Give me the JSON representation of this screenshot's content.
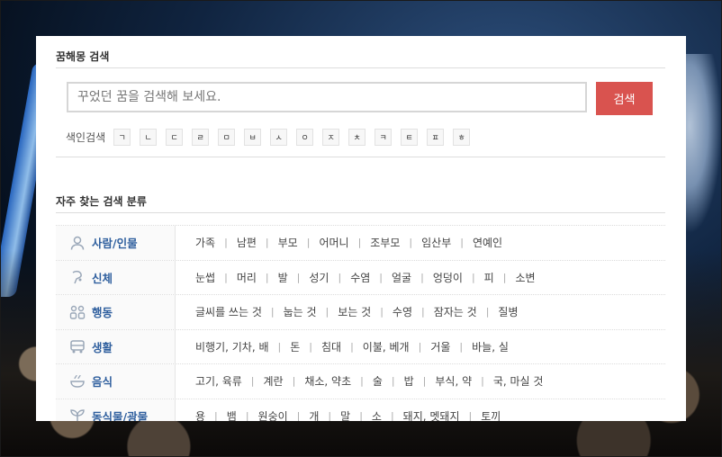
{
  "search": {
    "title": "꿈해몽 검색",
    "placeholder": "꾸었던 꿈을 검색해 보세요.",
    "button": "검색",
    "index_label": "색인검색",
    "index_keys": [
      "ㄱ",
      "ㄴ",
      "ㄷ",
      "ㄹ",
      "ㅁ",
      "ㅂ",
      "ㅅ",
      "ㅇ",
      "ㅈ",
      "ㅊ",
      "ㅋ",
      "ㅌ",
      "ㅍ",
      "ㅎ"
    ]
  },
  "categories": {
    "title": "자주 찾는 검색 분류",
    "accent_color": "#2f5f9e",
    "rows": [
      {
        "label": "사람/인물",
        "icon": "person-icon",
        "items": [
          "가족",
          "남편",
          "부모",
          "어머니",
          "조부모",
          "임산부",
          "연예인"
        ]
      },
      {
        "label": "신체",
        "icon": "body-icon",
        "items": [
          "눈썹",
          "머리",
          "발",
          "성기",
          "수염",
          "얼굴",
          "엉덩이",
          "피",
          "소변"
        ]
      },
      {
        "label": "행동",
        "icon": "people-icon",
        "items": [
          "글씨를 쓰는 것",
          "눕는 것",
          "보는 것",
          "수영",
          "잠자는 것",
          "질병"
        ]
      },
      {
        "label": "생활",
        "icon": "vehicle-icon",
        "items": [
          "비행기, 기차, 배",
          "돈",
          "침대",
          "이불, 베개",
          "거울",
          "바늘, 실"
        ]
      },
      {
        "label": "음식",
        "icon": "food-icon",
        "items": [
          "고기, 육류",
          "계란",
          "채소, 약초",
          "술",
          "밥",
          "부식, 약",
          "국, 마실 것"
        ]
      },
      {
        "label": "동식물/광물",
        "icon": "plant-icon",
        "items": [
          "용",
          "뱀",
          "원숭이",
          "개",
          "말",
          "소",
          "돼지, 멧돼지",
          "토끼"
        ]
      }
    ]
  },
  "colors": {
    "button": "#d9534f",
    "icon": "#9aa7b8"
  }
}
